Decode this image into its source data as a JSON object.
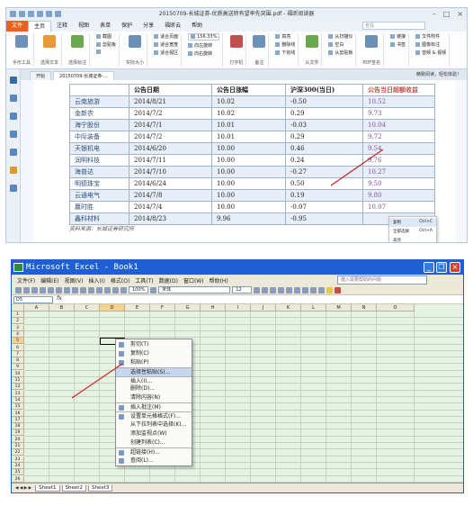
{
  "top_window": {
    "title": "20150709-长城证券-优质高送转有望率先突围.pdf - 福昕阅读器",
    "ribbon_tabs": [
      "文件",
      "主页",
      "注释",
      "视图",
      "表单",
      "保护",
      "分享",
      "福昕云",
      "帮助"
    ],
    "ribbon_search_placeholder": "查找",
    "ribbon_groups": [
      {
        "label": "手形工具",
        "kind": "big"
      },
      {
        "label": "选择文本",
        "kind": "big"
      },
      {
        "label": "选择标注",
        "kind": "big"
      },
      {
        "items": [
          "截图",
          "剪贴板",
          ""
        ],
        "kind": "rows"
      },
      {
        "label": "实际大小",
        "kind": "big"
      },
      {
        "items": [
          "适合页面",
          "适合宽度",
          "适合视区"
        ],
        "kind": "rows"
      },
      {
        "items": [
          "156.33%",
          "向左旋转",
          "向右旋转"
        ],
        "kind": "rows"
      },
      {
        "label": "打字机",
        "kind": "big"
      },
      {
        "label": "备注",
        "kind": "big"
      },
      {
        "items": [
          "高亮",
          "删除线",
          "下划线"
        ],
        "kind": "rows"
      },
      {
        "label": "从文件",
        "kind": "big"
      },
      {
        "items": [
          "从扫描仪",
          "空白",
          "从剪贴板"
        ],
        "kind": "rows"
      },
      {
        "label": "PDF签名",
        "kind": "big"
      },
      {
        "items": [
          "链接",
          "书签"
        ],
        "kind": "rows"
      },
      {
        "items": [
          "文件附件",
          "图像标注",
          "音频 & 视频"
        ],
        "kind": "rows"
      }
    ],
    "doc_tabs": [
      "开始",
      "20150709-长城证券-..."
    ],
    "help_link": "精致阅读，轻松体验！",
    "table_headers": [
      "",
      "公告日期",
      "公告日涨幅",
      "沪深300(当日)",
      "公告当日超额收益"
    ],
    "table_rows": [
      [
        "云南旅游",
        "2014/8/21",
        "10.02",
        "-0.50",
        "10.52"
      ],
      [
        "金新农",
        "2014/7/2",
        "10.02",
        "0.29",
        "9.73"
      ],
      [
        "海宁股份",
        "2014/7/1",
        "10.01",
        "-0.03",
        "10.04"
      ],
      [
        "中际装备",
        "2014/7/2",
        "10.01",
        "0.29",
        "9.72"
      ],
      [
        "天银机电",
        "2014/6/20",
        "10.00",
        "0.46",
        "9.54"
      ],
      [
        "润明科技",
        "2014/7/11",
        "10.00",
        "0.24",
        "9.76"
      ],
      [
        "海普达",
        "2014/7/10",
        "10.00",
        "-0.27",
        "10.27"
      ],
      [
        "明德珠宝",
        "2014/6/24",
        "10.00",
        "0.50",
        "9.50"
      ],
      [
        "云通电气",
        "2014/7/8",
        "10.00",
        "0.19",
        "9.80"
      ],
      [
        "赢时胜",
        "2014/7/4",
        "10.00",
        "-0.07",
        "10.07"
      ],
      [
        "鑫科材料",
        "2014/8/23",
        "9.96",
        "-0.95",
        ""
      ]
    ],
    "source_note": "资料来源：长城证券研究所",
    "context_menu": [
      {
        "label": "复制",
        "shortcut": "Ctrl+C"
      },
      {
        "label": "全部选择",
        "shortcut": "Ctrl+A"
      },
      {
        "label": "高亮",
        "shortcut": ""
      },
      {
        "label": "删除线",
        "shortcut": ""
      },
      {
        "label": "下划线",
        "shortcut": ""
      },
      {
        "label": "波浪下划线",
        "shortcut": ""
      },
      {
        "label": "替换",
        "shortcut": ""
      }
    ]
  },
  "excel": {
    "title": "Microsoft Excel - Book1",
    "menus": [
      "文件(F)",
      "编辑(E)",
      "视图(V)",
      "插入(I)",
      "格式(O)",
      "工具(T)",
      "数据(D)",
      "窗口(W)",
      "帮助(H)"
    ],
    "help_placeholder": "键入需要帮助的问题",
    "zoom": "100%",
    "font_name": "宋体",
    "font_size": "12",
    "name_box": "D5",
    "columns": [
      "A",
      "B",
      "C",
      "D",
      "E",
      "F",
      "G",
      "H",
      "I",
      "J",
      "K",
      "L",
      "M",
      "N",
      "O"
    ],
    "rows": [
      "1",
      "2",
      "3",
      "4",
      "5",
      "6",
      "7",
      "8",
      "9",
      "10",
      "11",
      "12",
      "13",
      "14",
      "15",
      "16",
      "17",
      "18",
      "19",
      "20",
      "21",
      "22",
      "23",
      "24",
      "25",
      "26"
    ],
    "context_menu": [
      {
        "label": "剪切(T)",
        "icon": "scissors-icon"
      },
      {
        "label": "复制(C)",
        "icon": "copy-icon"
      },
      {
        "label": "粘贴(P)",
        "icon": "paste-icon"
      },
      {
        "label": "选择性粘贴(S)...",
        "icon": ""
      },
      {
        "label": "插入(I)...",
        "icon": ""
      },
      {
        "label": "删除(D)...",
        "icon": ""
      },
      {
        "label": "清除内容(N)",
        "icon": ""
      },
      {
        "label": "插入批注(M)",
        "icon": "comment-icon"
      },
      {
        "label": "设置单元格格式(F)...",
        "icon": "format-icon"
      },
      {
        "label": "从下拉列表中选择(K)...",
        "icon": ""
      },
      {
        "label": "添加监视点(W)",
        "icon": ""
      },
      {
        "label": "创建列表(C)...",
        "icon": ""
      },
      {
        "label": "超链接(H)...",
        "icon": "link-icon"
      },
      {
        "label": "查阅(L)...",
        "icon": "lookup-icon"
      }
    ],
    "sheet_tabs": [
      "Sheet1",
      "Sheet2",
      "Sheet3"
    ],
    "nav_arrows": "◀ ◀ ▶ ▶"
  },
  "colors": {
    "accent_red": "#c0504d",
    "excel_blue": "#1e5fd4",
    "arrow": "#cc2222"
  }
}
